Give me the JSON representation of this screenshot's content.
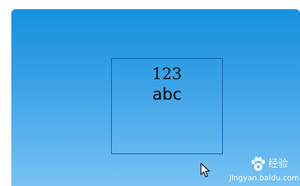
{
  "canvas": {
    "background_top": "#1590de",
    "background_bottom": "#78c3f4",
    "accent_border": "#0c5fa8"
  },
  "selection_box": {
    "line1": "123",
    "line2": "abc"
  },
  "cursor": {
    "icon": "mouse-pointer-icon"
  },
  "watermark": {
    "icon": "paw-icon",
    "brand": "经验",
    "url": "jingyan.baidu.com"
  }
}
